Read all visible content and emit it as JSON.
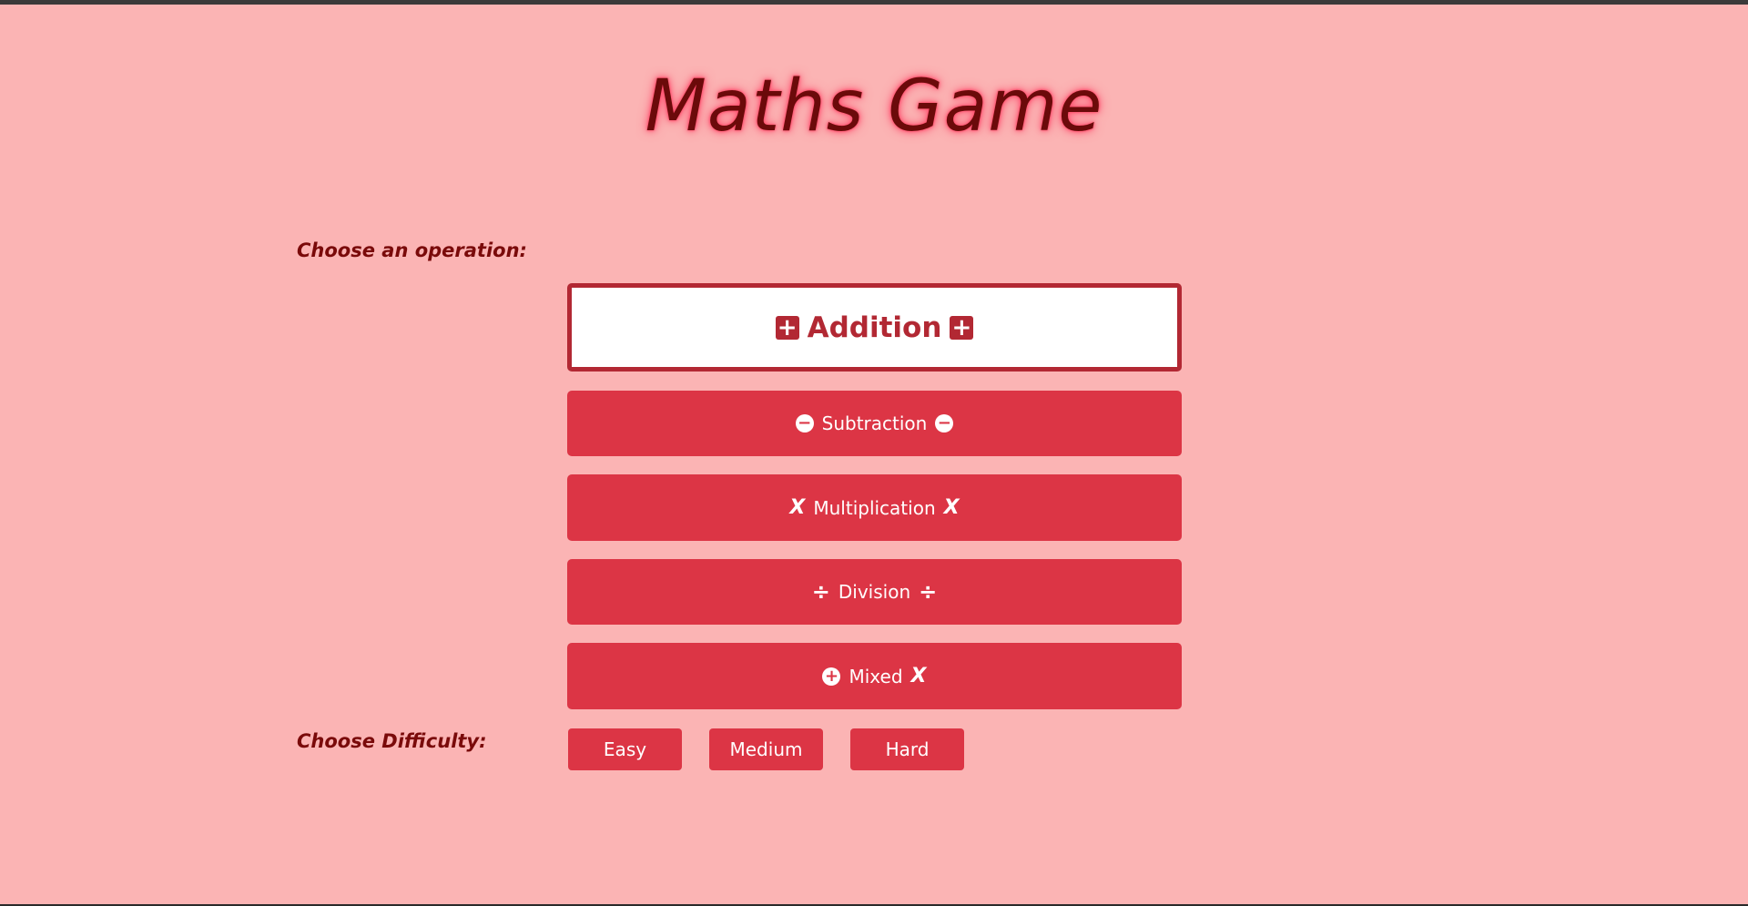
{
  "title": "Maths Game",
  "labels": {
    "operation": "Choose an operation:",
    "difficulty": "Choose Difficulty:"
  },
  "operations": [
    {
      "label": "Addition",
      "icon_left": "plus-square-icon",
      "icon_right": "plus-square-icon",
      "selected": true
    },
    {
      "label": "Subtraction",
      "icon_left": "minus-circle-icon",
      "icon_right": "minus-circle-icon",
      "selected": false
    },
    {
      "label": "Multiplication",
      "icon_left": "times-icon",
      "icon_right": "times-icon",
      "selected": false
    },
    {
      "label": "Division",
      "icon_left": "divide-icon",
      "icon_right": "divide-icon",
      "selected": false
    },
    {
      "label": "Mixed",
      "icon_left": "plus-circle-icon",
      "icon_right": "times-icon",
      "selected": false
    }
  ],
  "difficulties": [
    "Easy",
    "Medium",
    "Hard"
  ],
  "glyphs": {
    "plus": "+",
    "minus": "−",
    "times": "X",
    "divide": "÷"
  },
  "colors": {
    "background": "#fbb4b4",
    "button": "#dc3545",
    "selected_border": "#b22833",
    "title_text": "#6b0a0a",
    "title_glow": "#ff4d6d",
    "label_text": "#7a0a0a"
  }
}
